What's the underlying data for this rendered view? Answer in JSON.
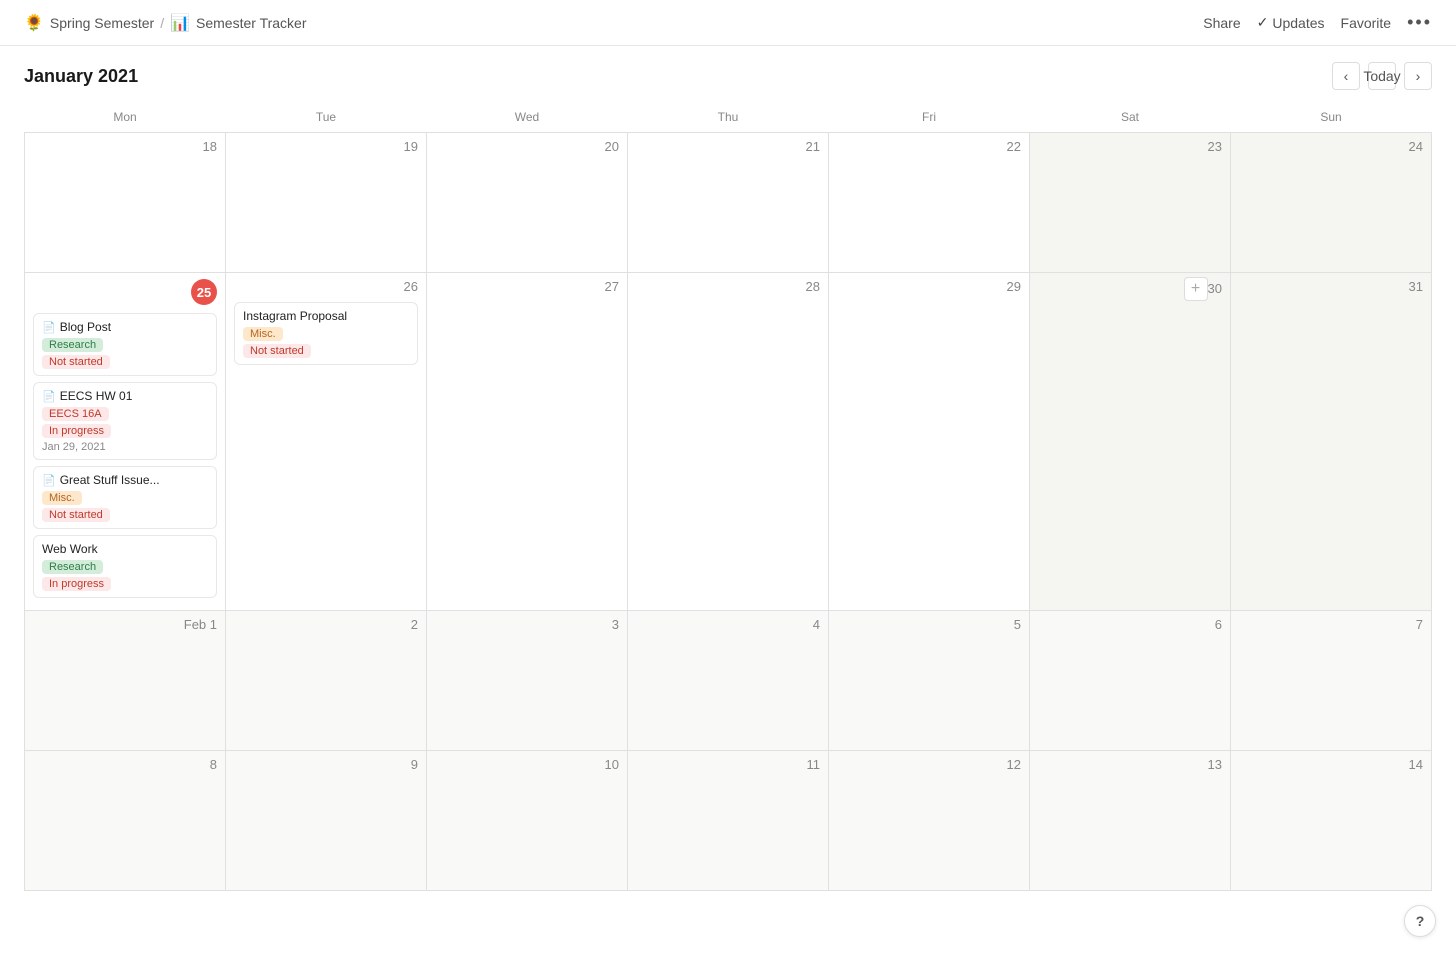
{
  "breadcrumb": {
    "parent_icon": "🌻",
    "parent_label": "Spring Semester",
    "separator": "/",
    "child_icon": "📊",
    "child_label": "Semester Tracker"
  },
  "top_actions": {
    "share_label": "Share",
    "updates_check": "✓",
    "updates_label": "Updates",
    "favorite_label": "Favorite",
    "more_label": "•••"
  },
  "calendar": {
    "title": "January 2021",
    "today_btn": "Today",
    "days_of_week": [
      "Mon",
      "Tue",
      "Wed",
      "Thu",
      "Fri",
      "Sat",
      "Sun"
    ],
    "weeks": [
      {
        "days": [
          {
            "num": "18",
            "weekend": false,
            "today": false,
            "events": []
          },
          {
            "num": "19",
            "weekend": false,
            "today": false,
            "events": []
          },
          {
            "num": "20",
            "weekend": false,
            "today": false,
            "events": []
          },
          {
            "num": "21",
            "weekend": false,
            "today": false,
            "events": []
          },
          {
            "num": "22",
            "weekend": false,
            "today": false,
            "events": []
          },
          {
            "num": "23",
            "weekend": true,
            "today": false,
            "events": []
          },
          {
            "num": "24",
            "weekend": true,
            "today": false,
            "events": []
          }
        ]
      },
      {
        "days": [
          {
            "num": "25",
            "weekend": false,
            "today": true,
            "events": [
              {
                "title": "Blog Post",
                "doc": true,
                "tags": [
                  {
                    "label": "Research",
                    "class": "tag-research"
                  },
                  {
                    "label": "Not started",
                    "class": "tag-not-started"
                  }
                ],
                "date": ""
              },
              {
                "title": "EECS HW 01",
                "doc": true,
                "tags": [
                  {
                    "label": "EECS 16A",
                    "class": "tag-eecs"
                  },
                  {
                    "label": "In progress",
                    "class": "tag-in-progress"
                  }
                ],
                "date": "Jan 29, 2021"
              },
              {
                "title": "Great Stuff Issue...",
                "doc": true,
                "tags": [
                  {
                    "label": "Misc.",
                    "class": "tag-misc"
                  },
                  {
                    "label": "Not started",
                    "class": "tag-not-started"
                  }
                ],
                "date": ""
              },
              {
                "title": "Web Work",
                "doc": false,
                "tags": [
                  {
                    "label": "Research",
                    "class": "tag-research"
                  },
                  {
                    "label": "In progress",
                    "class": "tag-in-progress"
                  }
                ],
                "date": ""
              }
            ]
          },
          {
            "num": "26",
            "weekend": false,
            "today": false,
            "events": [
              {
                "title": "Instagram Proposal",
                "doc": false,
                "tags": [
                  {
                    "label": "Misc.",
                    "class": "tag-misc"
                  },
                  {
                    "label": "Not started",
                    "class": "tag-not-started"
                  }
                ],
                "date": ""
              }
            ]
          },
          {
            "num": "27",
            "weekend": false,
            "today": false,
            "events": []
          },
          {
            "num": "28",
            "weekend": false,
            "today": false,
            "events": []
          },
          {
            "num": "29",
            "weekend": false,
            "today": false,
            "events": []
          },
          {
            "num": "30",
            "weekend": true,
            "today": false,
            "add_btn": true,
            "events": []
          },
          {
            "num": "31",
            "weekend": true,
            "today": false,
            "events": []
          }
        ]
      },
      {
        "days": [
          {
            "num": "Feb 1",
            "weekend": false,
            "today": false,
            "other_month": true,
            "events": []
          },
          {
            "num": "2",
            "weekend": false,
            "today": false,
            "other_month": true,
            "events": []
          },
          {
            "num": "3",
            "weekend": false,
            "today": false,
            "other_month": true,
            "events": []
          },
          {
            "num": "4",
            "weekend": false,
            "today": false,
            "other_month": true,
            "events": []
          },
          {
            "num": "5",
            "weekend": false,
            "today": false,
            "other_month": true,
            "events": []
          },
          {
            "num": "6",
            "weekend": true,
            "today": false,
            "other_month": true,
            "events": []
          },
          {
            "num": "7",
            "weekend": true,
            "today": false,
            "other_month": true,
            "events": []
          }
        ]
      },
      {
        "days": [
          {
            "num": "8",
            "weekend": false,
            "today": false,
            "other_month": true,
            "events": []
          },
          {
            "num": "9",
            "weekend": false,
            "today": false,
            "other_month": true,
            "events": []
          },
          {
            "num": "10",
            "weekend": false,
            "today": false,
            "other_month": true,
            "events": []
          },
          {
            "num": "11",
            "weekend": false,
            "today": false,
            "other_month": true,
            "events": []
          },
          {
            "num": "12",
            "weekend": false,
            "today": false,
            "other_month": true,
            "events": []
          },
          {
            "num": "13",
            "weekend": true,
            "today": false,
            "other_month": true,
            "events": []
          },
          {
            "num": "14",
            "weekend": true,
            "today": false,
            "other_month": true,
            "events": []
          }
        ]
      }
    ]
  },
  "help_btn_label": "?"
}
